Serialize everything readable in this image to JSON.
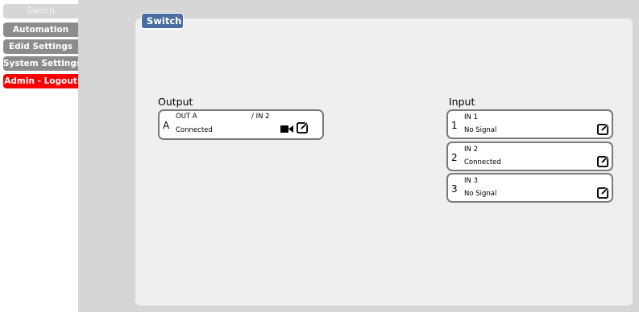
{
  "sidebar": {
    "items": [
      {
        "label": "Switch",
        "state": "active"
      },
      {
        "label": "Automation",
        "state": "default"
      },
      {
        "label": "Edid Settings",
        "state": "default"
      },
      {
        "label": "System Settings",
        "state": "default"
      },
      {
        "label": "Admin - Logout",
        "state": "logout"
      }
    ]
  },
  "panel": {
    "tab_label": "Switch"
  },
  "output": {
    "title": "Output",
    "ports": [
      {
        "letter": "A",
        "name": "OUT A",
        "route": "/ IN 2",
        "status": "Connected",
        "icons": [
          "video-camera-icon",
          "edit-icon"
        ]
      }
    ]
  },
  "input": {
    "title": "Input",
    "ports": [
      {
        "number": "1",
        "name": "IN 1",
        "status": "No Signal",
        "icon": "edit-icon"
      },
      {
        "number": "2",
        "name": "IN 2",
        "status": "Connected",
        "icon": "edit-icon"
      },
      {
        "number": "3",
        "name": "IN 3",
        "status": "No Signal",
        "icon": "edit-icon"
      }
    ]
  },
  "colors": {
    "sidebar_active": "#d6d6d6",
    "sidebar_default": "#8c8c8c",
    "sidebar_logout": "#f80000",
    "tab_blue": "#4a6fa0",
    "panel_bg": "#efefef",
    "main_bg": "#d6d6d6"
  }
}
